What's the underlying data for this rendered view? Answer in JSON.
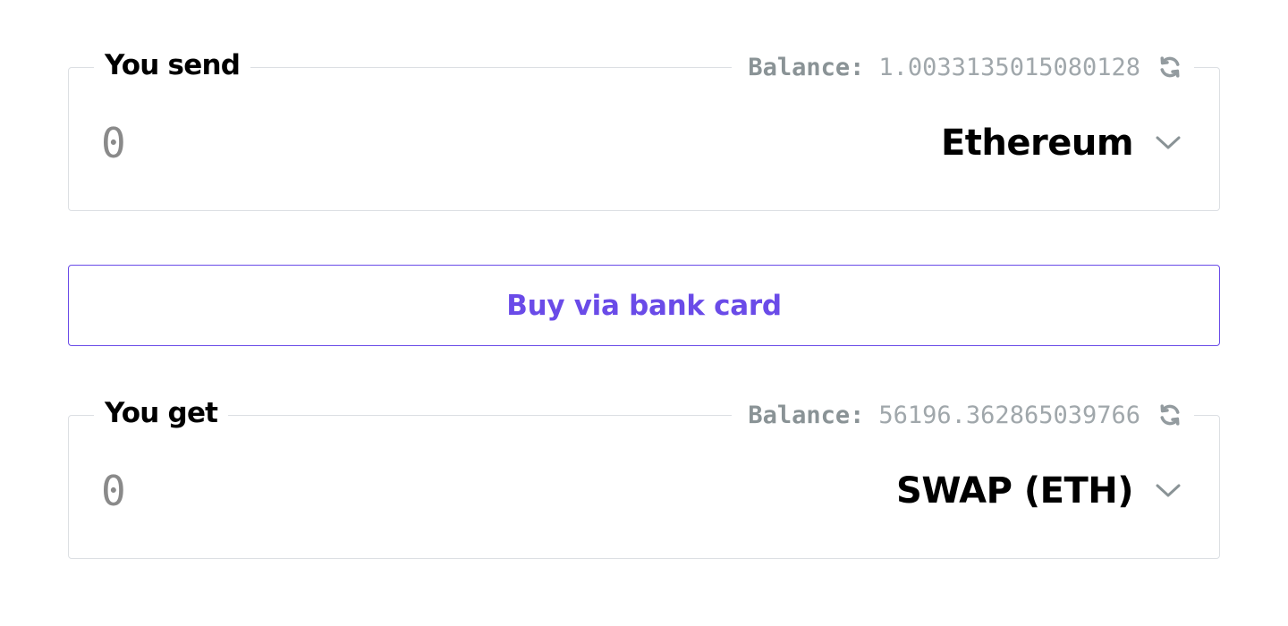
{
  "send": {
    "label": "You send",
    "balance_label": "Balance:",
    "balance_value": "1.0033135015080128",
    "amount_placeholder": "0",
    "currency": "Ethereum"
  },
  "buy_button": {
    "label": "Buy via bank card"
  },
  "get": {
    "label": "You get",
    "balance_label": "Balance:",
    "balance_value": "56196.362865039766",
    "amount_placeholder": "0",
    "currency": "SWAP (ETH)"
  },
  "icons": {
    "refresh": "refresh-icon",
    "chevron": "chevron-down-icon"
  },
  "colors": {
    "accent": "#6a4be8",
    "muted_text": "#939b9f",
    "border": "#dcdfe3"
  }
}
